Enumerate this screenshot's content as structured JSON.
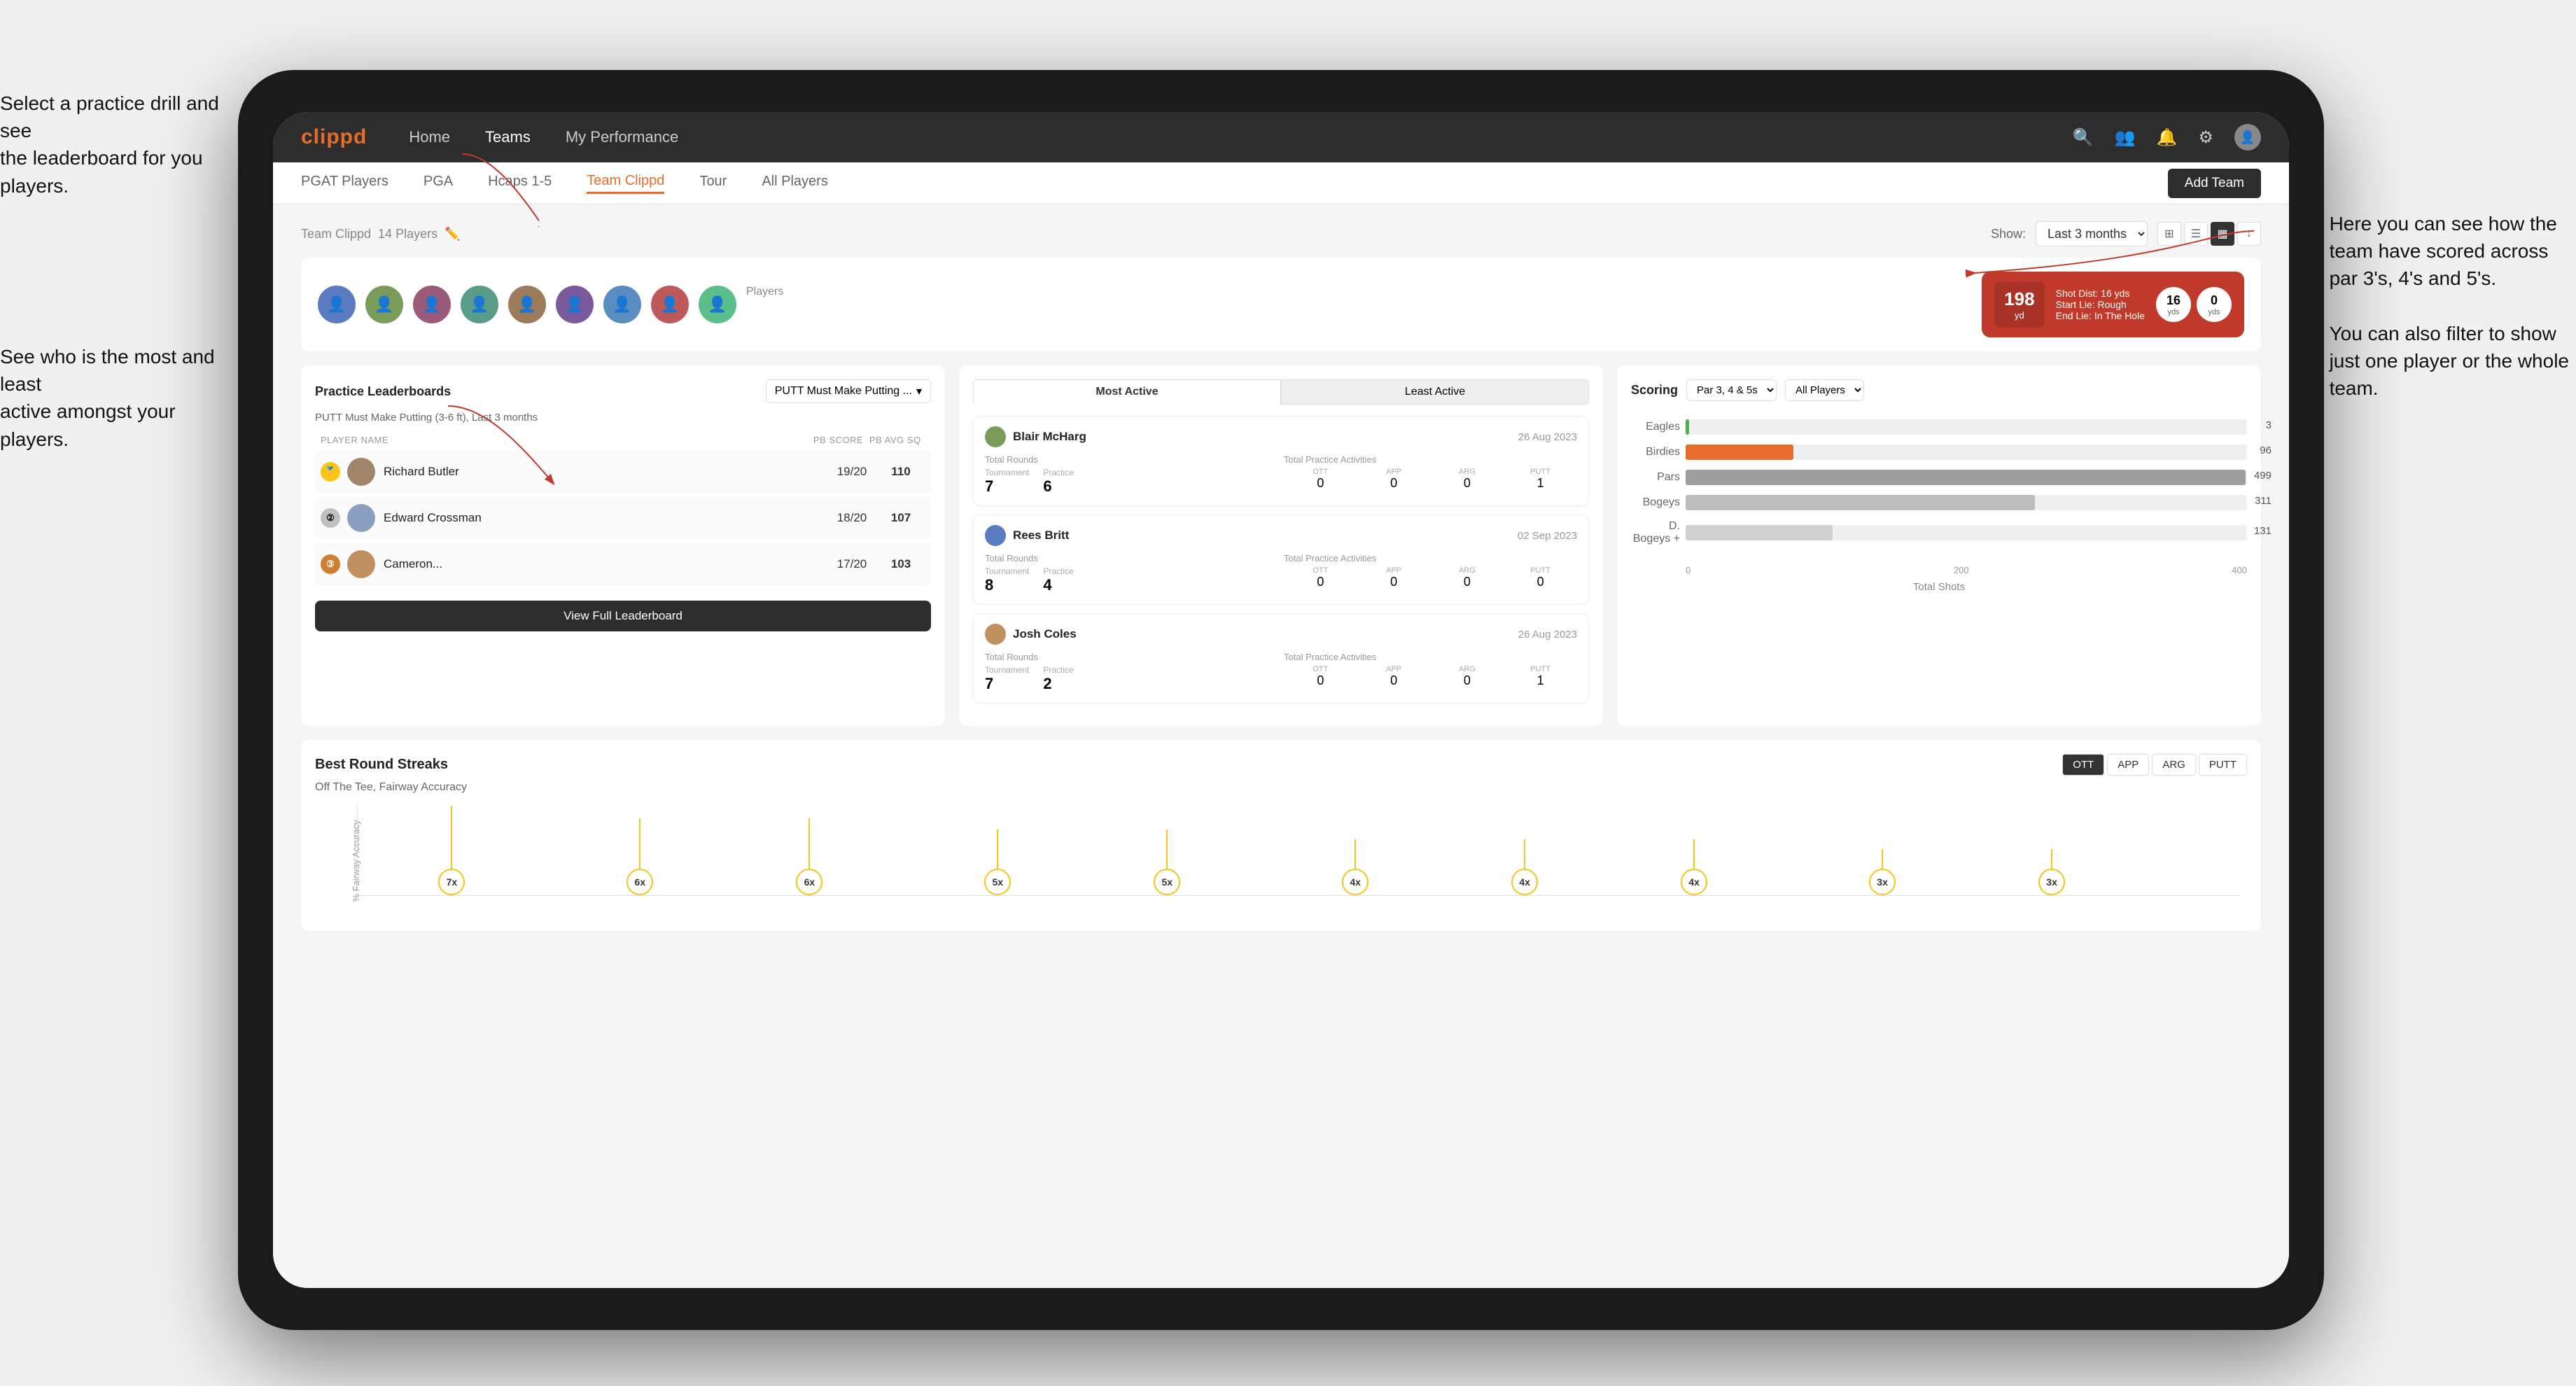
{
  "annotations": {
    "left1": "Select a practice drill and see\nthe leaderboard for you players.",
    "left2": "See who is the most and least\nactive amongst your players.",
    "right1": "Here you can see how the\nteam have scored across\npar 3's, 4's and 5's.",
    "right2": "You can also filter to show\njust one player or the whole\nteam."
  },
  "nav": {
    "logo": "clippd",
    "links": [
      "Home",
      "Teams",
      "My Performance"
    ],
    "active_link": "Teams"
  },
  "sub_nav": {
    "links": [
      "PGAT Players",
      "PGA",
      "Hcaps 1-5",
      "Team Clippd",
      "Tour",
      "All Players"
    ],
    "active": "Team Clippd",
    "add_team_label": "Add Team"
  },
  "team": {
    "name": "Team Clippd",
    "player_count": "14 Players",
    "show_label": "Show:",
    "show_value": "Last 3 months",
    "players_label": "Players"
  },
  "shot_card": {
    "number": "198",
    "unit": "yd",
    "shot_dist_label": "Shot Dist: 16 yds",
    "start_lie": "Start Lie: Rough",
    "end_lie": "End Lie: In The Hole",
    "yds_left": "16",
    "yds_left_label": "yds",
    "yds_right": "0",
    "yds_right_label": "yds"
  },
  "practice_leaderboards": {
    "title": "Practice Leaderboards",
    "dropdown": "PUTT Must Make Putting ...",
    "subtitle": "PUTT Must Make Putting (3-6 ft), Last 3 months",
    "col_player": "PLAYER NAME",
    "col_score": "PB SCORE",
    "col_avg": "PB AVG SQ",
    "players": [
      {
        "name": "Richard Butler",
        "score": "19/20",
        "avg": "110",
        "rank": "gold"
      },
      {
        "name": "Edward Crossman",
        "score": "18/20",
        "avg": "107",
        "rank": "silver"
      },
      {
        "name": "Cameron...",
        "score": "17/20",
        "avg": "103",
        "rank": "bronze"
      }
    ],
    "view_full_label": "View Full Leaderboard"
  },
  "activity": {
    "tabs": [
      "Most Active",
      "Least Active"
    ],
    "active_tab": "Most Active",
    "players": [
      {
        "name": "Blair McHarg",
        "date": "26 Aug 2023",
        "total_rounds_label": "Total Rounds",
        "tournament": "7",
        "practice": "6",
        "total_practice_label": "Total Practice Activities",
        "ott": "0",
        "app": "0",
        "arg": "0",
        "putt": "1"
      },
      {
        "name": "Rees Britt",
        "date": "02 Sep 2023",
        "total_rounds_label": "Total Rounds",
        "tournament": "8",
        "practice": "4",
        "total_practice_label": "Total Practice Activities",
        "ott": "0",
        "app": "0",
        "arg": "0",
        "putt": "0"
      },
      {
        "name": "Josh Coles",
        "date": "26 Aug 2023",
        "total_rounds_label": "Total Rounds",
        "tournament": "7",
        "practice": "2",
        "total_practice_label": "Total Practice Activities",
        "ott": "0",
        "app": "0",
        "arg": "0",
        "putt": "1"
      }
    ]
  },
  "scoring": {
    "title": "Scoring",
    "filter1": "Par 3, 4 & 5s",
    "filter2": "All Players",
    "bars": [
      {
        "label": "Eagles",
        "value": 3,
        "max": 500,
        "color": "bar-eagles",
        "display": "3"
      },
      {
        "label": "Birdies",
        "value": 96,
        "max": 500,
        "color": "bar-birdies",
        "display": "96"
      },
      {
        "label": "Pars",
        "value": 499,
        "max": 500,
        "color": "bar-pars",
        "display": "499"
      },
      {
        "label": "Bogeys",
        "value": 311,
        "max": 500,
        "color": "bar-bogeys",
        "display": "311"
      },
      {
        "label": "D. Bogeys +",
        "value": 131,
        "max": 500,
        "color": "bar-dbogeys",
        "display": "131"
      }
    ],
    "x_labels": [
      "0",
      "200",
      "400"
    ],
    "x_axis_label": "Total Shots"
  },
  "streaks": {
    "title": "Best Round Streaks",
    "tabs": [
      "OTT",
      "APP",
      "ARG",
      "PUTT"
    ],
    "active_tab": "OTT",
    "subtitle": "Off The Tee, Fairway Accuracy",
    "y_label": "% Fairway Accuracy",
    "points": [
      {
        "x_pct": 5,
        "height": 90,
        "label": "7x"
      },
      {
        "x_pct": 15,
        "height": 72,
        "label": "6x"
      },
      {
        "x_pct": 24,
        "height": 72,
        "label": "6x"
      },
      {
        "x_pct": 34,
        "height": 56,
        "label": "5x"
      },
      {
        "x_pct": 43,
        "height": 56,
        "label": "5x"
      },
      {
        "x_pct": 53,
        "height": 42,
        "label": "4x"
      },
      {
        "x_pct": 62,
        "height": 42,
        "label": "4x"
      },
      {
        "x_pct": 71,
        "height": 42,
        "label": "4x"
      },
      {
        "x_pct": 81,
        "height": 28,
        "label": "3x"
      },
      {
        "x_pct": 90,
        "height": 28,
        "label": "3x"
      }
    ]
  }
}
